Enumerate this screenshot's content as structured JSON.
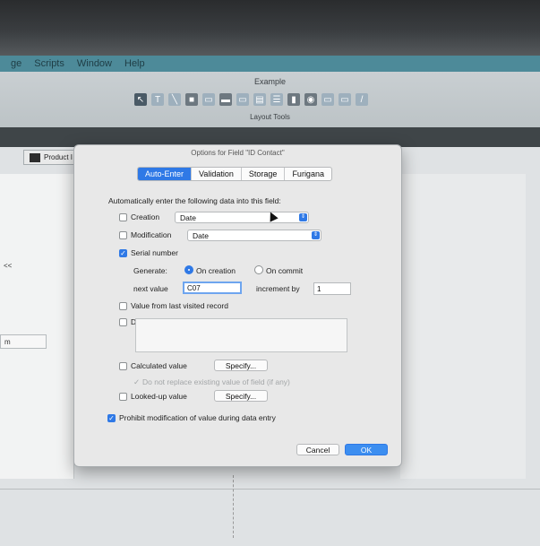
{
  "menubar": {
    "items": [
      "ge",
      "Scripts",
      "Window",
      "Help"
    ]
  },
  "toolbar": {
    "title": "Example",
    "subtitle": "Layout Tools"
  },
  "layout": {
    "product_tab": "Product I",
    "left_text": "<<",
    "left_field": "m"
  },
  "dialog": {
    "title": "Options for Field \"ID Contact\"",
    "tabs": [
      "Auto-Enter",
      "Validation",
      "Storage",
      "Furigana"
    ],
    "active_tab": "Auto-Enter",
    "instruction": "Automatically enter the following data into this field:",
    "creation": {
      "label": "Creation",
      "checked": false,
      "value": "Date"
    },
    "modification": {
      "label": "Modification",
      "checked": false,
      "value": "Date"
    },
    "serial": {
      "label": "Serial number",
      "checked": true
    },
    "generate": {
      "label": "Generate:",
      "on_creation": "On creation",
      "on_commit": "On commit",
      "selected": "On creation"
    },
    "next_value": {
      "label": "next value",
      "value": "C07"
    },
    "increment": {
      "label": "increment by",
      "value": "1"
    },
    "last_visited": {
      "label": "Value from last visited record",
      "checked": false
    },
    "data": {
      "label": "Data:",
      "checked": false,
      "value": ""
    },
    "calculated": {
      "label": "Calculated value",
      "checked": false,
      "button": "Specify..."
    },
    "do_not_replace": {
      "label": "Do not replace existing value of field (if any)",
      "checked": true
    },
    "lookup": {
      "label": "Looked-up value",
      "checked": false,
      "button": "Specify..."
    },
    "prohibit": {
      "label": "Prohibit modification of value during data entry",
      "checked": true
    },
    "cancel": "Cancel",
    "ok": "OK"
  }
}
